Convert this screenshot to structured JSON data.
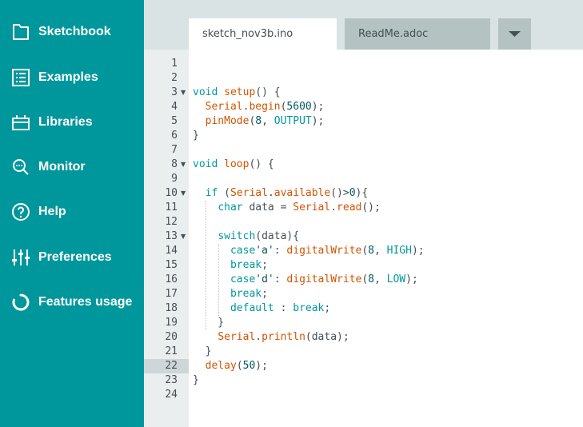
{
  "sidebar": {
    "items": [
      {
        "label": "Sketchbook",
        "icon": "folder-icon"
      },
      {
        "label": "Examples",
        "icon": "list-icon"
      },
      {
        "label": "Libraries",
        "icon": "library-icon"
      },
      {
        "label": "Monitor",
        "icon": "monitor-search-icon"
      },
      {
        "label": "Help",
        "icon": "help-icon"
      },
      {
        "label": "Preferences",
        "icon": "sliders-icon"
      },
      {
        "label": "Features usage",
        "icon": "progress-circle-icon"
      }
    ]
  },
  "tabs": [
    {
      "label": "sketch_nov3b.ino",
      "active": true
    },
    {
      "label": "ReadMe.adoc",
      "active": false
    }
  ],
  "tab_menu": {
    "icon": "caret-down-icon"
  },
  "editor": {
    "active_line": 22,
    "folded_lines": [
      3,
      8,
      10,
      13
    ],
    "lines": [
      [],
      [],
      [
        [
          "k",
          "void"
        ],
        [
          "p",
          " "
        ],
        [
          "f",
          "setup"
        ],
        [
          "p",
          "() {"
        ]
      ],
      [
        [
          "p",
          "  "
        ],
        [
          "f",
          "Serial"
        ],
        [
          "p",
          "."
        ],
        [
          "f",
          "begin"
        ],
        [
          "p",
          "("
        ],
        [
          "n",
          "5600"
        ],
        [
          "p",
          ");"
        ]
      ],
      [
        [
          "p",
          "  "
        ],
        [
          "f",
          "pinMode"
        ],
        [
          "p",
          "("
        ],
        [
          "n",
          "8"
        ],
        [
          "p",
          ", "
        ],
        [
          "c",
          "OUTPUT"
        ],
        [
          "p",
          ");"
        ]
      ],
      [
        [
          "p",
          "}"
        ]
      ],
      [],
      [
        [
          "k",
          "void"
        ],
        [
          "p",
          " "
        ],
        [
          "f",
          "loop"
        ],
        [
          "p",
          "() {"
        ]
      ],
      [],
      [
        [
          "p",
          "  "
        ],
        [
          "k",
          "if"
        ],
        [
          "p",
          " ("
        ],
        [
          "f",
          "Serial"
        ],
        [
          "p",
          "."
        ],
        [
          "f",
          "available"
        ],
        [
          "p",
          "()>"
        ],
        [
          "n",
          "0"
        ],
        [
          "p",
          "){"
        ]
      ],
      [
        [
          "p",
          "    "
        ],
        [
          "k",
          "char"
        ],
        [
          "p",
          " data = "
        ],
        [
          "f",
          "Serial"
        ],
        [
          "p",
          "."
        ],
        [
          "f",
          "read"
        ],
        [
          "p",
          "();"
        ]
      ],
      [],
      [
        [
          "p",
          "    "
        ],
        [
          "k",
          "switch"
        ],
        [
          "p",
          "(data){"
        ]
      ],
      [
        [
          "p",
          "      "
        ],
        [
          "k",
          "case"
        ],
        [
          "s",
          "'a'"
        ],
        [
          "p",
          ": "
        ],
        [
          "f",
          "digitalWrite"
        ],
        [
          "p",
          "("
        ],
        [
          "n",
          "8"
        ],
        [
          "p",
          ", "
        ],
        [
          "c",
          "HIGH"
        ],
        [
          "p",
          ");"
        ]
      ],
      [
        [
          "p",
          "      "
        ],
        [
          "k",
          "break"
        ],
        [
          "p",
          ";"
        ]
      ],
      [
        [
          "p",
          "      "
        ],
        [
          "k",
          "case"
        ],
        [
          "s",
          "'d'"
        ],
        [
          "p",
          ": "
        ],
        [
          "f",
          "digitalWrite"
        ],
        [
          "p",
          "("
        ],
        [
          "n",
          "8"
        ],
        [
          "p",
          ", "
        ],
        [
          "c",
          "LOW"
        ],
        [
          "p",
          ");"
        ]
      ],
      [
        [
          "p",
          "      "
        ],
        [
          "k",
          "break"
        ],
        [
          "p",
          ";"
        ]
      ],
      [
        [
          "p",
          "      "
        ],
        [
          "k",
          "default"
        ],
        [
          "p",
          " : "
        ],
        [
          "k",
          "break"
        ],
        [
          "p",
          ";"
        ]
      ],
      [
        [
          "p",
          "    }"
        ]
      ],
      [
        [
          "p",
          "    "
        ],
        [
          "f",
          "Serial"
        ],
        [
          "p",
          "."
        ],
        [
          "f",
          "println"
        ],
        [
          "p",
          "(data);"
        ]
      ],
      [
        [
          "p",
          "  }"
        ]
      ],
      [
        [
          "p",
          "  "
        ],
        [
          "f",
          "delay"
        ],
        [
          "p",
          "("
        ],
        [
          "n",
          "50"
        ],
        [
          "p",
          ");"
        ]
      ],
      [
        [
          "p",
          "}"
        ]
      ],
      []
    ]
  }
}
